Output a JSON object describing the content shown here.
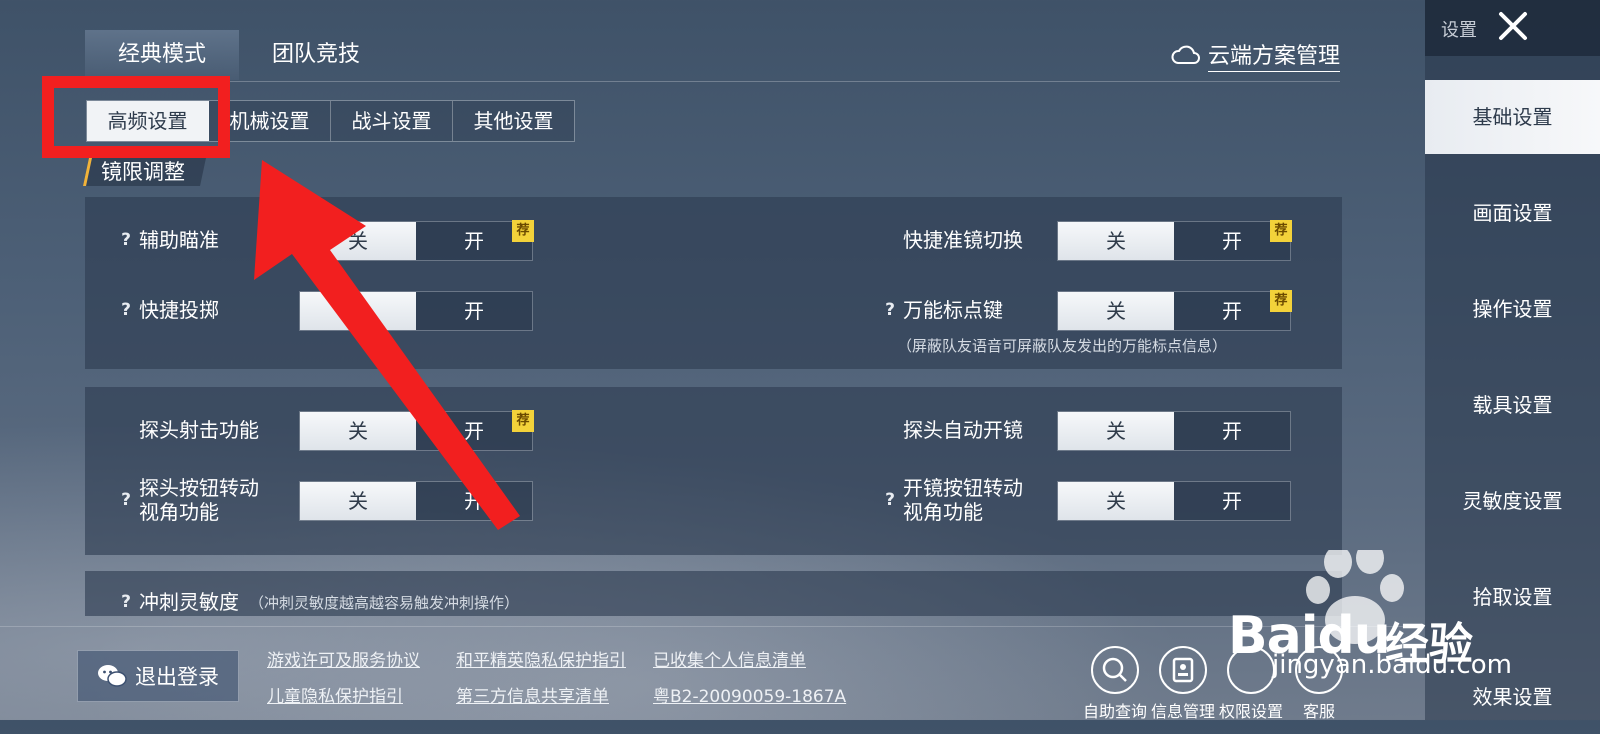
{
  "mode_tabs": [
    "经典模式",
    "团队竞技"
  ],
  "cloud_link": "云端方案管理",
  "sub_tabs": [
    "高频设置",
    "机械设置",
    "战斗设置",
    "其他设置"
  ],
  "section_title": "镜限调整",
  "settings": {
    "aim_assist": {
      "label": "辅助瞄准",
      "off": "关",
      "on": "开",
      "badge": "荐"
    },
    "quick_scope": {
      "label": "快捷准镜切换",
      "off": "关",
      "on": "开",
      "badge": "荐"
    },
    "quick_throw": {
      "label": "快捷投掷",
      "off": "关",
      "on": "开"
    },
    "universal_mark": {
      "label": "万能标点键",
      "off": "关",
      "on": "开",
      "badge": "荐",
      "note": "（屏蔽队友语音可屏蔽队友发出的万能标点信息）"
    },
    "peek_fire": {
      "label": "探头射击功能",
      "off": "关",
      "on": "开",
      "badge": "荐"
    },
    "peek_auto_scope": {
      "label": "探头自动开镜",
      "off": "关",
      "on": "开"
    },
    "peek_rotate": {
      "label_line1": "探头按钮转动",
      "label_line2": "视角功能",
      "off": "关",
      "on": "开"
    },
    "scope_rotate": {
      "label_line1": "开镜按钮转动",
      "label_line2": "视角功能",
      "off": "关",
      "on": "开"
    },
    "sprint": {
      "label": "冲刺灵敏度",
      "note": "（冲刺灵敏度越高越容易触发冲刺操作）"
    }
  },
  "right_nav": {
    "title": "设置",
    "items": [
      "基础设置",
      "画面设置",
      "操作设置",
      "载具设置",
      "灵敏度设置",
      "拾取设置",
      "效果设置"
    ]
  },
  "footer": {
    "logout": "退出登录",
    "links": [
      "游戏许可及服务协议",
      "和平精英隐私保护指引",
      "已收集个人信息清单",
      "儿童隐私保护指引",
      "第三方信息共享清单",
      "粤B2-20090059-1867A"
    ],
    "icons": [
      "自助查询",
      "信息管理",
      "权限设置",
      "客服"
    ]
  },
  "watermark": {
    "brand": "Baidu",
    "brand_cn": "经验",
    "url": "jingyan.baidu.com"
  },
  "colors": {
    "annotation_red": "#f21f1f",
    "badge_yellow": "#f3d23a",
    "accent_gold": "#f2b33a"
  }
}
